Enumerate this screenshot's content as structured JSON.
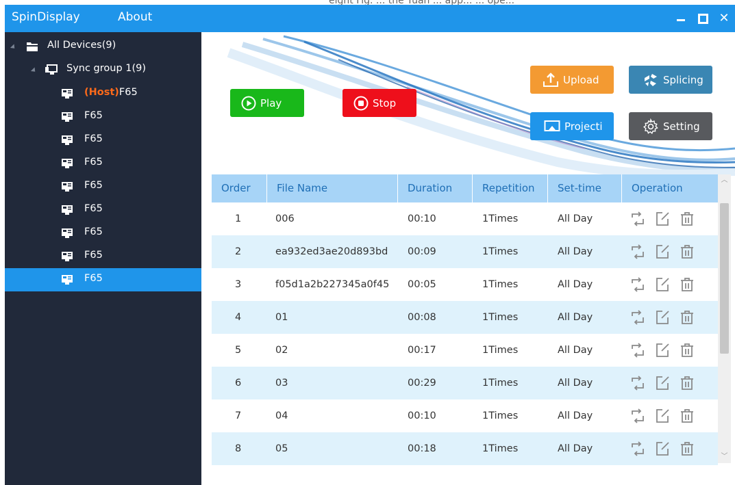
{
  "top_strip_text": "eight Fig. ... the Yuan ... app... ... ope...",
  "titlebar": {
    "app_title": "SpinDisplay",
    "about": "About"
  },
  "tree": {
    "root": "All Devices(9)",
    "group": "Sync group 1(9)",
    "host_prefix": "(Host)",
    "host_name": "F65",
    "devices": [
      "F65",
      "F65",
      "F65",
      "F65",
      "F65",
      "F65",
      "F65",
      "F65"
    ]
  },
  "buttons": {
    "play": "Play",
    "stop": "Stop",
    "upload": "Upload",
    "splicing": "Splicing",
    "projection": "Projecti",
    "setting": "Setting"
  },
  "table": {
    "headers": [
      "Order",
      "File Name",
      "Duration",
      "Repetition",
      "Set-time",
      "Operation"
    ],
    "rows": [
      {
        "order": "1",
        "name": "006",
        "duration": "00:10",
        "rep": "1Times",
        "time": "All Day"
      },
      {
        "order": "2",
        "name": "ea932ed3ae20d893bd",
        "duration": "00:09",
        "rep": "1Times",
        "time": "All Day"
      },
      {
        "order": "3",
        "name": "f05d1a2b227345a0f45",
        "duration": "00:05",
        "rep": "1Times",
        "time": "All Day"
      },
      {
        "order": "4",
        "name": "01",
        "duration": "00:08",
        "rep": "1Times",
        "time": "All Day"
      },
      {
        "order": "5",
        "name": "02",
        "duration": "00:17",
        "rep": "1Times",
        "time": "All Day"
      },
      {
        "order": "6",
        "name": "03",
        "duration": "00:29",
        "rep": "1Times",
        "time": "All Day"
      },
      {
        "order": "7",
        "name": "04",
        "duration": "00:10",
        "rep": "1Times",
        "time": "All Day"
      },
      {
        "order": "8",
        "name": "05",
        "duration": "00:18",
        "rep": "1Times",
        "time": "All Day"
      }
    ]
  },
  "colors": {
    "titlebar": "#1f95ea",
    "sidebar": "#21293a",
    "host": "#ff6a1a",
    "play": "#19b81a",
    "stop": "#ee0f1b",
    "upload": "#f39a32",
    "splicing": "#3a86b3",
    "projection": "#1f95ea",
    "setting": "#585a5e"
  }
}
